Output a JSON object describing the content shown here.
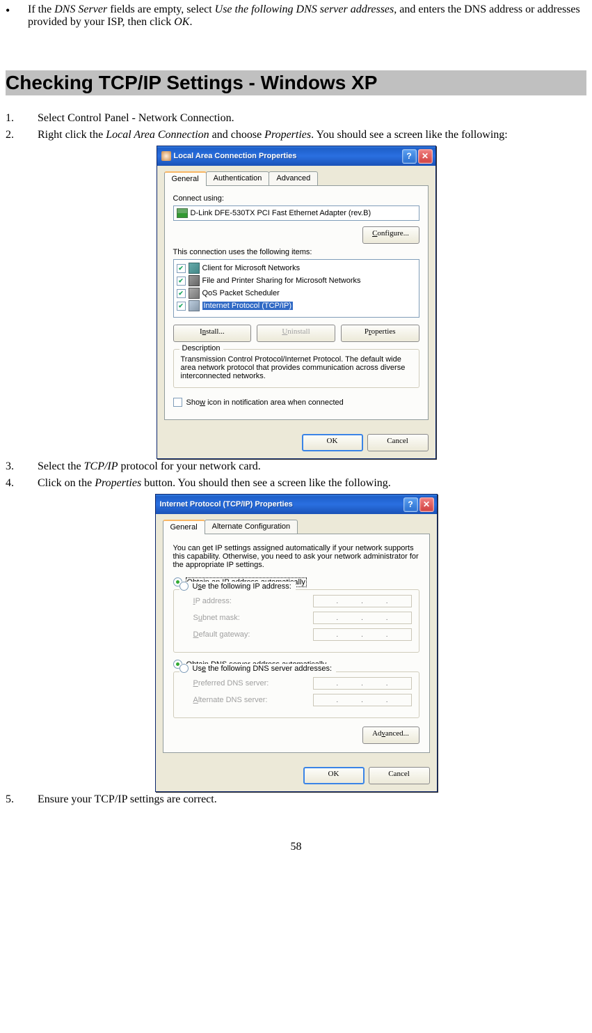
{
  "intro": {
    "bullet": "•",
    "text_pre": "If the ",
    "dns_server": "DNS Server",
    "text_mid1": " fields are empty, select ",
    "use_following": "Use the following DNS server addresses",
    "text_mid2": ", and enters the DNS address or addresses provided by your ISP, then click ",
    "ok": "OK",
    "text_end": "."
  },
  "heading": "Checking TCP/IP Settings - Windows XP",
  "steps": {
    "s1": {
      "num": "1.",
      "text": "Select Control Panel - Network Connection."
    },
    "s2": {
      "num": "2.",
      "pre": "Right click the ",
      "lac": "Local Area Connection",
      "mid": " and choose ",
      "props": "Properties",
      "post": ". You should see a screen like the following:"
    },
    "s3": {
      "num": "3.",
      "pre": "Select the ",
      "tcpip": "TCP/IP",
      "post": " protocol for your network card."
    },
    "s4": {
      "num": "4.",
      "pre": "Click on the ",
      "props": "Properties",
      "post": " button. You should then see a screen like the following."
    },
    "s5": {
      "num": "5.",
      "text": "Ensure your TCP/IP settings are correct."
    }
  },
  "dialog1": {
    "title": "Local Area Connection Properties",
    "tabs": {
      "general": "General",
      "auth": "Authentication",
      "adv": "Advanced"
    },
    "connect_using": "Connect using:",
    "adapter": "D-Link DFE-530TX PCI Fast Ethernet Adapter (rev.B)",
    "configure": "Configure...",
    "conn_items_label": "This connection uses the following items:",
    "items": {
      "client": "Client for Microsoft Networks",
      "share": "File and Printer Sharing for Microsoft Networks",
      "qos": "QoS Packet Scheduler",
      "tcpip": "Internet Protocol (TCP/IP)"
    },
    "install": "Install...",
    "uninstall": "Uninstall",
    "properties": "Properties",
    "desc_title": "Description",
    "desc_text": "Transmission Control Protocol/Internet Protocol. The default wide area network protocol that provides communication across diverse interconnected networks.",
    "show_icon_pre": "Sho",
    "show_icon_u": "w",
    "show_icon_post": " icon in notification area when connected",
    "ok": "OK",
    "cancel": "Cancel"
  },
  "dialog2": {
    "title": "Internet Protocol (TCP/IP) Properties",
    "tabs": {
      "general": "General",
      "alt": "Alternate Configuration"
    },
    "intro": "You can get IP settings assigned automatically if your network supports this capability. Otherwise, you need to ask your network administrator for the appropriate IP settings.",
    "obtain_ip_u": "O",
    "obtain_ip": "btain an IP address automatically",
    "use_ip": "Use the following IP address:",
    "ip_addr": "IP address:",
    "subnet": "Subnet mask:",
    "gateway": "Default gateway:",
    "obtain_dns_pre": "O",
    "obtain_dns_u": "b",
    "obtain_dns_post": "tain DNS server address automatically",
    "use_dns": "Use the following DNS server addresses:",
    "pref_dns": "Preferred DNS server:",
    "alt_dns": "Alternate DNS server:",
    "advanced": "Advanced...",
    "ok": "OK",
    "cancel": "Cancel"
  },
  "page_number": "58"
}
